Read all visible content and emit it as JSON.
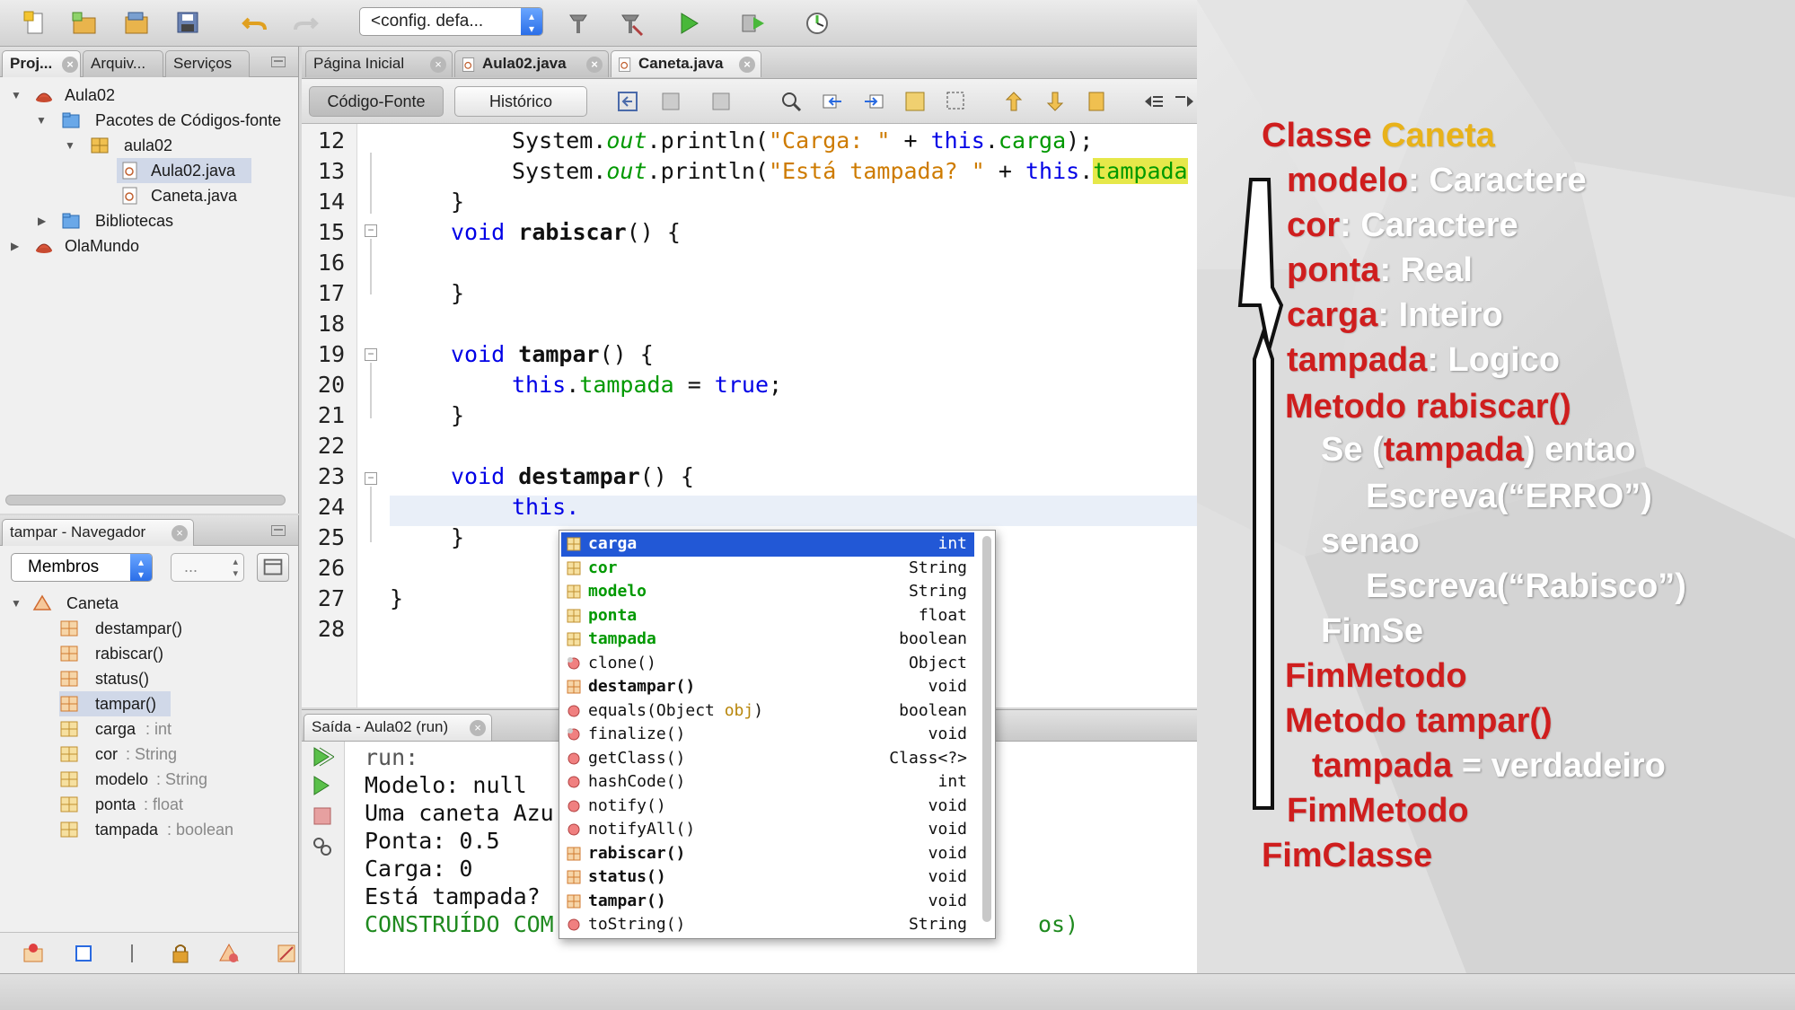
{
  "toolbar": {
    "config_select": "<config. defa...",
    "icons": [
      "new-file-icon",
      "new-project-icon",
      "open-project-icon",
      "save-all-icon",
      "undo-icon",
      "redo-icon",
      "build-icon",
      "clean-build-icon",
      "run-icon",
      "debug-icon",
      "profile-icon"
    ]
  },
  "projects_panel": {
    "tabs": [
      {
        "label": "Proj...",
        "active": true
      },
      {
        "label": "Arquiv...",
        "active": false
      },
      {
        "label": "Serviços",
        "active": false
      }
    ],
    "tree": [
      {
        "label": "Aula02",
        "level": 0,
        "expanded": true,
        "icon": "project-icon"
      },
      {
        "label": "Pacotes de Códigos-fonte",
        "level": 1,
        "expanded": true,
        "icon": "source-packages-icon"
      },
      {
        "label": "aula02",
        "level": 2,
        "expanded": true,
        "icon": "package-icon"
      },
      {
        "label": "Aula02.java",
        "level": 3,
        "selected": true,
        "icon": "java-file-icon"
      },
      {
        "label": "Caneta.java",
        "level": 3,
        "icon": "java-file-icon"
      },
      {
        "label": "Bibliotecas",
        "level": 1,
        "expanded": false,
        "icon": "libraries-icon"
      },
      {
        "label": "OlaMundo",
        "level": 0,
        "expanded": false,
        "icon": "project-icon"
      }
    ]
  },
  "navigator_panel": {
    "tab_label": "tampar - Navegador",
    "filter_select": "Membros",
    "filter_field": "...",
    "root": "Caneta",
    "members": [
      {
        "name": "destampar()",
        "type": ""
      },
      {
        "name": "rabiscar()",
        "type": ""
      },
      {
        "name": "status()",
        "type": ""
      },
      {
        "name": "tampar()",
        "type": "",
        "selected": true
      },
      {
        "name": "carga",
        "type": " : int"
      },
      {
        "name": "cor",
        "type": " : String"
      },
      {
        "name": "modelo",
        "type": " : String"
      },
      {
        "name": "ponta",
        "type": " : float"
      },
      {
        "name": "tampada",
        "type": " : boolean"
      }
    ]
  },
  "editor": {
    "tabs": [
      {
        "label": "Página Inicial",
        "active": false
      },
      {
        "label": "Aula02.java",
        "active": false
      },
      {
        "label": "Caneta.java",
        "active": true
      }
    ],
    "modes": {
      "source": "Código-Fonte",
      "history": "Histórico"
    },
    "line_numbers": [
      "12",
      "13",
      "14",
      "15",
      "16",
      "17",
      "18",
      "19",
      "20",
      "21",
      "22",
      "23",
      "24",
      "25",
      "26",
      "27",
      "28"
    ],
    "code": {
      "l12_a": "System.",
      "l12_b": "out",
      "l12_c": ".println(",
      "l12_d": "\"Carga: \"",
      "l12_e": " + ",
      "l12_f": "this",
      "l12_g": ".",
      "l12_h": "carga",
      "l12_i": ");",
      "l13_a": "System.",
      "l13_b": "out",
      "l13_c": ".println(",
      "l13_d": "\"Está tampada? \"",
      "l13_e": " + ",
      "l13_f": "this",
      "l13_g": ".",
      "l13_h": "tampada",
      "l14": "}",
      "l15_kw": "void",
      "l15_name": "rabiscar",
      "l15_rest": "() {",
      "l17": "}",
      "l19_kw": "void",
      "l19_name": "tampar",
      "l19_rest": "() {",
      "l20_this": "this",
      "l20_dot": ".",
      "l20_field": "tampada",
      "l20_eq": " = ",
      "l20_val": "true",
      "l20_end": ";",
      "l21": "}",
      "l23_kw": "void",
      "l23_name": "destampar",
      "l23_rest": "() {",
      "l24": "this.",
      "l25": "}",
      "l27": "}"
    }
  },
  "completion": {
    "items": [
      {
        "name": "carga",
        "type": "int",
        "kind": "field",
        "selected": true
      },
      {
        "name": "cor",
        "type": "String",
        "kind": "field"
      },
      {
        "name": "modelo",
        "type": "String",
        "kind": "field"
      },
      {
        "name": "ponta",
        "type": "float",
        "kind": "field"
      },
      {
        "name": "tampada",
        "type": "boolean",
        "kind": "field"
      },
      {
        "name": "clone()",
        "type": "Object",
        "kind": "inherited"
      },
      {
        "name": "destampar()",
        "type": "void",
        "kind": "method"
      },
      {
        "name": "equals(Object ",
        "param": "obj",
        "name_end": ")",
        "type": "boolean",
        "kind": "inherited"
      },
      {
        "name": "finalize()",
        "type": "void",
        "kind": "inherited"
      },
      {
        "name": "getClass()",
        "type": "Class<?>",
        "kind": "inherited"
      },
      {
        "name": "hashCode()",
        "type": "int",
        "kind": "inherited"
      },
      {
        "name": "notify()",
        "type": "void",
        "kind": "inherited"
      },
      {
        "name": "notifyAll()",
        "type": "void",
        "kind": "inherited"
      },
      {
        "name": "rabiscar()",
        "type": "void",
        "kind": "method"
      },
      {
        "name": "status()",
        "type": "void",
        "kind": "method"
      },
      {
        "name": "tampar()",
        "type": "void",
        "kind": "method"
      },
      {
        "name": "toString()",
        "type": "String",
        "kind": "inherited"
      }
    ]
  },
  "output": {
    "tab_label": "Saída - Aula02 (run)",
    "lines": [
      {
        "text": "run:",
        "style": "gray"
      },
      {
        "text": "Modelo: null",
        "style": "normal"
      },
      {
        "text": "Uma caneta Azu",
        "style": "normal"
      },
      {
        "text": "Ponta: 0.5",
        "style": "normal"
      },
      {
        "text": "Carga: 0",
        "style": "normal"
      },
      {
        "text": "Está tampada?",
        "style": "normal"
      },
      {
        "text": "CONSTRUÍDO COM",
        "style": "green"
      }
    ],
    "trailing_text": "os)"
  },
  "slide": {
    "classe_kw": "Classe",
    "classe_name": "Caneta",
    "attrs": [
      {
        "name": "modelo",
        "type": ": Caractere"
      },
      {
        "name": "cor",
        "type": ": Caractere"
      },
      {
        "name": "ponta",
        "type": ": Real"
      },
      {
        "name": "carga",
        "type": ": Inteiro"
      },
      {
        "name": "tampada",
        "type": ": Logico"
      }
    ],
    "m1_kw": "Metodo",
    "m1_name": "rabiscar()",
    "se_a": "Se (",
    "se_b": "tampada",
    "se_c": ") entao",
    "escreva1": "Escreva(“ERRO”)",
    "senao": "senao",
    "escreva2": "Escreva(“Rabisco”)",
    "fimse": "FimSe",
    "fimmetodo1": "FimMetodo",
    "m2_kw": "Metodo",
    "m2_name": "tampar()",
    "assign_a": "tampada",
    "assign_b": " = verdadeiro",
    "fimmetodo2": "FimMetodo",
    "fimclasse": "FimClasse"
  },
  "colors": {
    "accent": "#2258d6",
    "slide_red": "#cf1e1e",
    "slide_gold": "#e8b21a",
    "keyword": "#0000e6",
    "string": "#ce7b00",
    "field": "#009900"
  }
}
